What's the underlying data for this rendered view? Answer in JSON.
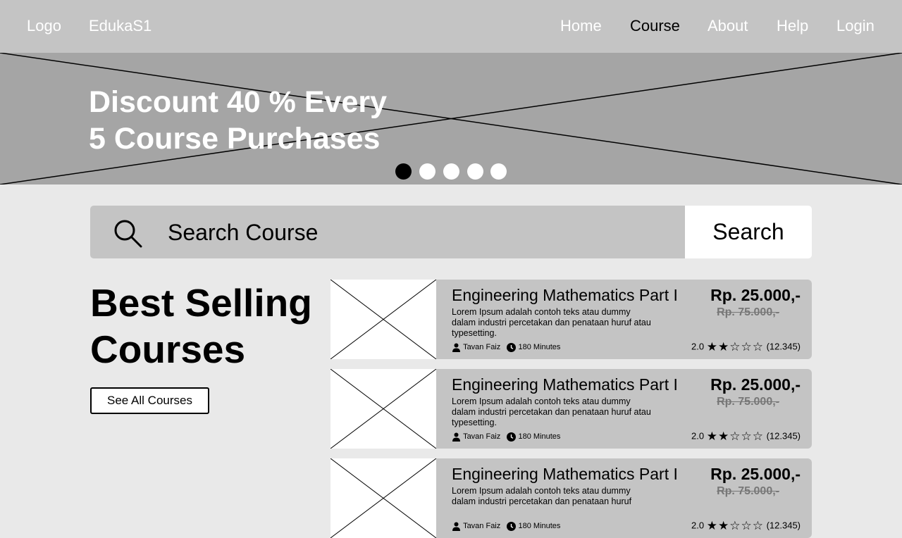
{
  "nav": {
    "logo": "Logo",
    "brand": "EdukaS1",
    "links": [
      "Home",
      "Course",
      "About",
      "Help",
      "Login"
    ],
    "active": "Course"
  },
  "hero": {
    "line1": "Discount 40 % Every",
    "line2": "5 Course Purchases",
    "slides": 5,
    "active_slide": 1
  },
  "search": {
    "placeholder": "Search Course",
    "button": "Search"
  },
  "best": {
    "title_line1": "Best Selling",
    "title_line2": "Courses",
    "see_all": "See All Courses"
  },
  "courses": [
    {
      "title": "Engineering Mathematics Part I",
      "desc": "Lorem Ipsum adalah contoh teks atau dummy dalam industri percetakan dan penataan huruf atau typesetting.",
      "author": "Tavan Faiz",
      "duration": "180 Minutes",
      "price": "Rp. 25.000,-",
      "old_price": "Rp. 75.000,-",
      "rating": "2.0",
      "stars": 2,
      "reviews": "(12.345)"
    },
    {
      "title": "Engineering Mathematics Part I",
      "desc": "Lorem Ipsum adalah contoh teks atau dummy dalam industri percetakan dan penataan huruf atau typesetting.",
      "author": "Tavan Faiz",
      "duration": "180 Minutes",
      "price": "Rp. 25.000,-",
      "old_price": "Rp. 75.000,-",
      "rating": "2.0",
      "stars": 2,
      "reviews": "(12.345)"
    },
    {
      "title": "Engineering Mathematics Part I",
      "desc": "Lorem Ipsum adalah contoh teks atau dummy dalam industri percetakan dan penataan huruf",
      "author": "Tavan Faiz",
      "duration": "180 Minutes",
      "price": "Rp. 25.000,-",
      "old_price": "Rp. 75.000,-",
      "rating": "2.0",
      "stars": 2,
      "reviews": "(12.345)"
    }
  ]
}
